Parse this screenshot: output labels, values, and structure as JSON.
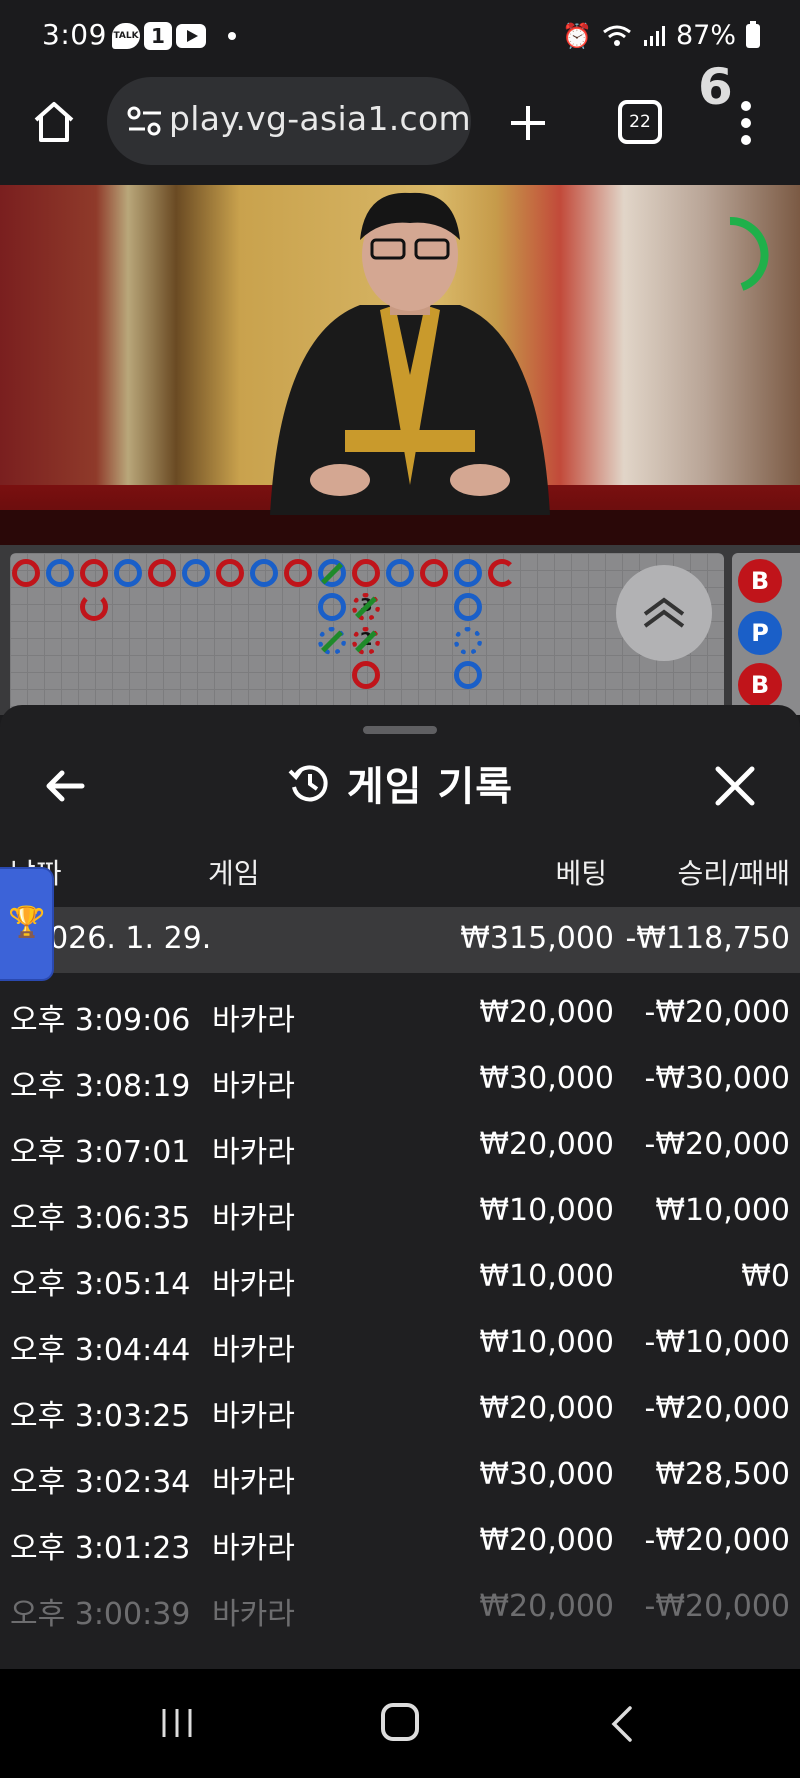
{
  "status_bar": {
    "time": "3:09",
    "talk_label": "TALK",
    "notif_count": "1",
    "battery": "87%"
  },
  "browser": {
    "url": "play.vg-asia1.com",
    "tab_count": "22"
  },
  "video": {
    "countdown": "6"
  },
  "scoreboard": {
    "side_chips": [
      "B",
      "P",
      "B"
    ],
    "bead_numbers": [
      "3",
      "2"
    ]
  },
  "sheet": {
    "title": "게임 기록",
    "columns": {
      "date": "날짜",
      "game": "게임",
      "bet": "베팅",
      "win_loss": "승리/패배"
    },
    "summary": {
      "date": "2026. 1. 29.",
      "bet": "₩315,000",
      "win_loss": "-₩118,750"
    },
    "rows": [
      {
        "time": "오후 3:09:06",
        "game": "바카라",
        "bet": "₩20,000",
        "win_loss": "-₩20,000"
      },
      {
        "time": "오후 3:08:19",
        "game": "바카라",
        "bet": "₩30,000",
        "win_loss": "-₩30,000"
      },
      {
        "time": "오후 3:07:01",
        "game": "바카라",
        "bet": "₩20,000",
        "win_loss": "-₩20,000"
      },
      {
        "time": "오후 3:06:35",
        "game": "바카라",
        "bet": "₩10,000",
        "win_loss": "₩10,000"
      },
      {
        "time": "오후 3:05:14",
        "game": "바카라",
        "bet": "₩10,000",
        "win_loss": "₩0"
      },
      {
        "time": "오후 3:04:44",
        "game": "바카라",
        "bet": "₩10,000",
        "win_loss": "-₩10,000"
      },
      {
        "time": "오후 3:03:25",
        "game": "바카라",
        "bet": "₩20,000",
        "win_loss": "-₩20,000"
      },
      {
        "time": "오후 3:02:34",
        "game": "바카라",
        "bet": "₩30,000",
        "win_loss": "₩28,500"
      },
      {
        "time": "오후 3:01:23",
        "game": "바카라",
        "bet": "₩20,000",
        "win_loss": "-₩20,000"
      },
      {
        "time": "오후 3:00:39",
        "game": "바카라",
        "bet": "₩20,000",
        "win_loss": "-₩20,000"
      }
    ]
  },
  "colors": {
    "banker": "#c0141a",
    "player": "#1a5fc8",
    "tie": "#1f8a2a",
    "sheet_bg": "#1f1f21",
    "summary_bg": "#3a3a3c",
    "trophy_tab": "#3c63d8"
  },
  "icons": {
    "home": "home-icon",
    "site_settings": "tune-icon",
    "new_tab": "plus-icon",
    "tabs": "tabs-counter-icon",
    "menu": "more-vert-icon",
    "back": "arrow-left-icon",
    "history": "history-icon",
    "close": "close-icon",
    "expand": "double-chevron-up-icon",
    "trophy": "trophy-icon"
  }
}
